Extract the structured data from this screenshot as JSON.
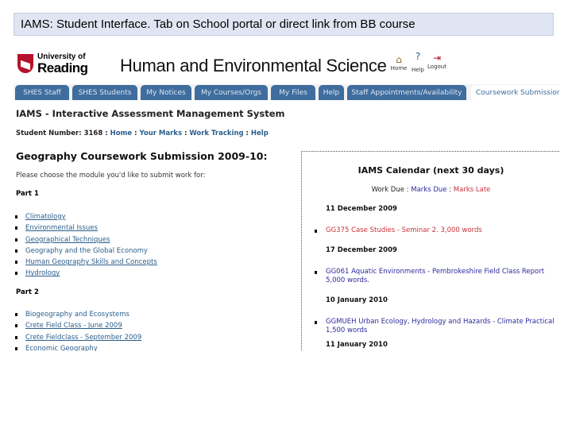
{
  "banner": {
    "caption": "IAMS: Student Interface. Tab on School portal or direct link from BB course"
  },
  "header": {
    "logo_line1": "University of",
    "logo_line2": "Reading",
    "site_title": "Human and Environmental Science",
    "icons": [
      {
        "name": "home-icon",
        "label": "Home"
      },
      {
        "name": "help-icon",
        "label": "Help"
      },
      {
        "name": "logout-icon",
        "label": "Logout"
      }
    ]
  },
  "tabs": [
    "SHES Staff",
    "SHES Students",
    "My Notices",
    "My Courses/Orgs",
    "My Files",
    "Help",
    "Staff Appointments/Availability",
    "Coursework Submission"
  ],
  "active_tab": "Coursework Submission",
  "colors": {
    "tab": "#3f6d9e",
    "link": "#2a5e8c",
    "marks_due": "#2e2a9c",
    "marks_late": "#c8323a"
  },
  "page": {
    "system_title": "IAMS - Interactive Assessment Management System",
    "student_label": "Student Number: 3168",
    "sep": " : ",
    "nav": [
      "Home",
      "Your Marks",
      "Work Tracking",
      "Help"
    ],
    "heading": "Geography Coursework Submission 2009-10:",
    "prompt": "Please choose the module you'd like to submit work for:",
    "part1": {
      "label": "Part 1",
      "modules": [
        "Climatology",
        "Environmental Issues",
        "Geographical Techniques",
        "Geography and the Global Economy",
        "Human Geography Skills and Concepts",
        "Hydrology"
      ]
    },
    "part2": {
      "label": "Part 2",
      "modules": [
        "Biogeography and Ecosystems",
        "Crete Field Class - June 2009",
        "Crete Fieldclass - September 2009",
        "Economic Geography"
      ]
    }
  },
  "calendar": {
    "title": "IAMS Calendar (next 30 days)",
    "legend": {
      "work_due": "Work Due",
      "sep": " : ",
      "marks_due": "Marks Due",
      "marks_late": "Marks Late"
    },
    "entries": [
      {
        "date": "11 December 2009",
        "item": "GG375 Case Studies - Seminar 2. 3,000 words",
        "status": "marks_late"
      },
      {
        "date": "17 December 2009",
        "item": "GG061 Aquatic Environments - Pembrokeshire Field Class Report 5,000 words.",
        "status": "marks_due"
      },
      {
        "date": "10 January 2010",
        "item": "GGMUEH Urban Ecology, Hydrology and Hazards - Climate Practical 1,500 words",
        "status": "marks_due"
      },
      {
        "date": "11 January 2010"
      }
    ]
  }
}
